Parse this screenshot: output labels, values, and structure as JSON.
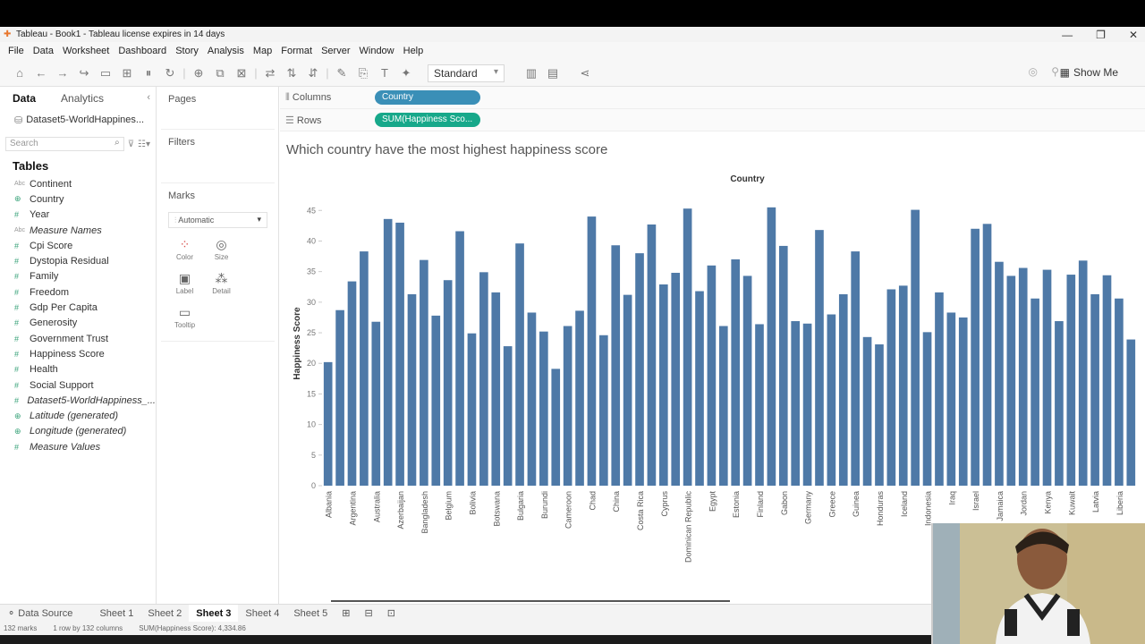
{
  "window": {
    "title": "Tableau - Book1 - Tableau license expires in 14 days",
    "controls": [
      "—",
      "❐",
      "✕"
    ]
  },
  "menu": [
    "File",
    "Data",
    "Worksheet",
    "Dashboard",
    "Story",
    "Analysis",
    "Map",
    "Format",
    "Server",
    "Window",
    "Help"
  ],
  "toolbar": {
    "fit": "Standard",
    "show_me": "Show Me"
  },
  "left_pane": {
    "tabs": [
      "Data",
      "Analytics"
    ],
    "datasource": "Dataset5-WorldHappines...",
    "search_placeholder": "Search",
    "tables_header": "Tables",
    "fields": [
      {
        "name": "Continent",
        "type": "Abc",
        "italic": false
      },
      {
        "name": "Country",
        "type": "geo",
        "italic": false
      },
      {
        "name": "Year",
        "type": "#",
        "italic": false
      },
      {
        "name": "Measure Names",
        "type": "Abc",
        "italic": true
      },
      {
        "name": "Cpi Score",
        "type": "#",
        "italic": false
      },
      {
        "name": "Dystopia Residual",
        "type": "#",
        "italic": false
      },
      {
        "name": "Family",
        "type": "#",
        "italic": false
      },
      {
        "name": "Freedom",
        "type": "#",
        "italic": false
      },
      {
        "name": "Gdp Per Capita",
        "type": "#",
        "italic": false
      },
      {
        "name": "Generosity",
        "type": "#",
        "italic": false
      },
      {
        "name": "Government Trust",
        "type": "#",
        "italic": false
      },
      {
        "name": "Happiness Score",
        "type": "#",
        "italic": false
      },
      {
        "name": "Health",
        "type": "#",
        "italic": false
      },
      {
        "name": "Social Support",
        "type": "#",
        "italic": false
      },
      {
        "name": "Dataset5-WorldHappiness_...",
        "type": "#",
        "italic": true
      },
      {
        "name": "Latitude (generated)",
        "type": "geo",
        "italic": true
      },
      {
        "name": "Longitude (generated)",
        "type": "geo",
        "italic": true
      },
      {
        "name": "Measure Values",
        "type": "#",
        "italic": true
      }
    ]
  },
  "cards": {
    "pages": "Pages",
    "filters": "Filters",
    "marks": "Marks",
    "mark_type": "Automatic",
    "mark_buttons": [
      "Color",
      "Size",
      "Label",
      "Detail",
      "Tooltip"
    ]
  },
  "shelves": {
    "columns_label": "Columns",
    "rows_label": "Rows",
    "columns_pill": "Country",
    "rows_pill": "SUM(Happiness Sco..."
  },
  "viz_title": "Which country have the most highest happiness score",
  "sheets": [
    "Data Source",
    "Sheet 1",
    "Sheet 2",
    "Sheet 3",
    "Sheet 4",
    "Sheet 5"
  ],
  "active_sheet": "Sheet 3",
  "status": {
    "marks": "132 marks",
    "rows": "1 row by 132 columns",
    "sum": "SUM(Happiness Score): 4,334.86"
  },
  "chart_data": {
    "type": "bar",
    "title": "Country",
    "ylabel": "Happiness Score",
    "ylim": [
      0,
      45
    ],
    "yticks": [
      0,
      5,
      10,
      15,
      20,
      25,
      30,
      35,
      40,
      45
    ],
    "bar_color": "#4e79a7",
    "tick_labels": [
      "Albania",
      "Argentina",
      "Australia",
      "Azerbaijan",
      "Bangladesh",
      "Belgium",
      "Bolivia",
      "Botswana",
      "Bulgaria",
      "Burundi",
      "Cameroon",
      "Chad",
      "China",
      "Costa Rica",
      "Cyprus",
      "Dominican Republic",
      "Egypt",
      "Estonia",
      "Finland",
      "Gabon",
      "Germany",
      "Greece",
      "Guinea",
      "Honduras",
      "Iceland",
      "Indonesia",
      "Iraq",
      "Israel",
      "Jamaica",
      "Jordan",
      "Kenya",
      "Kuwait",
      "Latvia",
      "Liberia"
    ],
    "values": [
      20.2,
      28.7,
      33.4,
      38.3,
      26.8,
      43.6,
      43.0,
      31.3,
      36.9,
      27.8,
      33.6,
      41.6,
      24.9,
      34.9,
      31.6,
      22.8,
      39.6,
      28.3,
      25.2,
      19.1,
      26.1,
      28.6,
      44.0,
      24.6,
      39.3,
      31.2,
      38.0,
      42.7,
      32.9,
      34.8,
      45.3,
      31.8,
      36.0,
      26.1,
      37.0,
      34.3,
      26.4,
      45.5,
      39.2,
      26.9,
      26.5,
      41.8,
      28.0,
      31.3,
      38.3,
      24.3,
      23.1,
      32.1,
      32.7,
      45.1,
      25.1,
      31.6,
      28.3,
      27.5,
      42.0,
      42.8,
      36.6,
      34.3,
      35.6,
      30.6,
      35.3,
      26.9,
      34.5,
      36.8,
      31.3,
      34.4,
      30.6,
      23.9
    ]
  }
}
